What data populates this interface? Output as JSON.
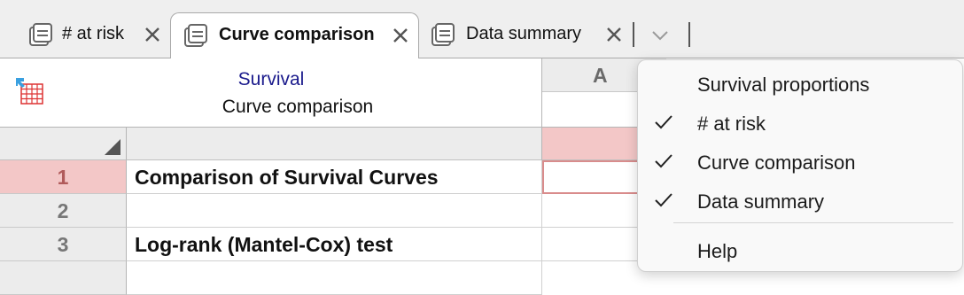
{
  "tabs": [
    {
      "label": "# at risk",
      "active": false
    },
    {
      "label": "Curve comparison",
      "active": true
    },
    {
      "label": "Data summary",
      "active": false
    }
  ],
  "sheet": {
    "title": "Survival",
    "subtitle": "Curve comparison",
    "column_header": "A",
    "rows": [
      {
        "number": "1",
        "text": "Comparison of Survival Curves",
        "selected": true
      },
      {
        "number": "2",
        "text": "",
        "selected": false
      },
      {
        "number": "3",
        "text": "Log-rank (Mantel-Cox) test",
        "selected": false
      }
    ]
  },
  "menu": {
    "items": [
      {
        "label": "Survival proportions",
        "checked": false
      },
      {
        "label": "# at risk",
        "checked": true
      },
      {
        "label": "Curve comparison",
        "checked": true
      },
      {
        "label": "Data summary",
        "checked": true
      },
      {
        "label": "Help",
        "checked": false
      }
    ]
  },
  "colors": {
    "accent_pink": "#f3c7c7",
    "title_blue": "#1a1a8c",
    "header_gray": "#ececec"
  }
}
